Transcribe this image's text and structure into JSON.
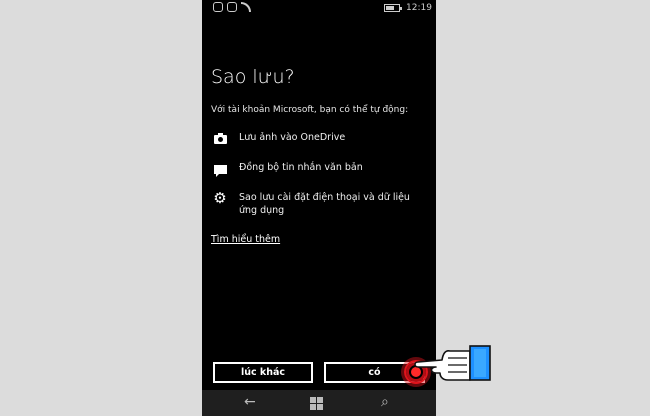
{
  "status_bar": {
    "time": "12:19",
    "battery_level": 0.7,
    "icons": [
      "notification-icon",
      "notification-icon",
      "wifi-icon"
    ]
  },
  "dialog": {
    "title": "Sao lưu?",
    "subtitle": "Với tài khoản Microsoft, bạn có thể tự động:",
    "features": [
      {
        "icon": "camera-icon",
        "label": "Lưu ảnh vào OneDrive"
      },
      {
        "icon": "message-icon",
        "label": "Đồng bộ tin nhắn văn bản"
      },
      {
        "icon": "gear-icon",
        "label": "Sao lưu cài đặt điện thoại và dữ liệu ứng dụng"
      }
    ],
    "learn_more": "Tìm hiểu thêm"
  },
  "buttons": {
    "later": "lúc khác",
    "yes": "có"
  },
  "nav_bar": {
    "back_icon": "back-arrow-icon",
    "start_icon": "windows-logo-icon",
    "search_icon": "search-icon"
  },
  "colors": {
    "screen_bg": "#000000",
    "page_bg": "#dcdcdc",
    "tap_indicator": "#e0141c",
    "hand_cuff": "#1e90ff"
  }
}
